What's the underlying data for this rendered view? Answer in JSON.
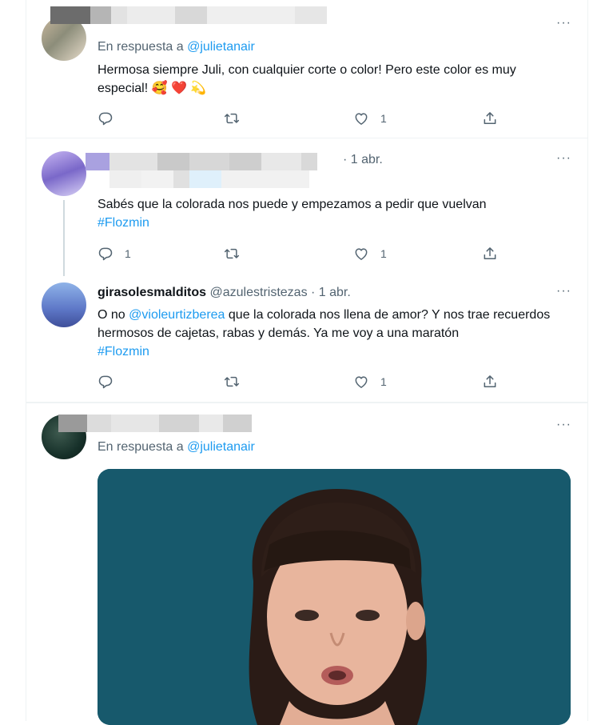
{
  "tweets": [
    {
      "reply_prefix": "En respuesta a",
      "reply_handle": "@julietanair",
      "text": "Hermosa siempre Juli, con cualquier corte o color! Pero este color es muy especial! 🥰 ❤️ 💫",
      "counts": {
        "reply": "",
        "retweet": "",
        "like": "1"
      }
    },
    {
      "meta_suffix": "· 1 abr.",
      "text": "Sabés que la colorada nos puede y empezamos a pedir que vuelvan",
      "hashtag": "#Flozmin",
      "counts": {
        "reply": "1",
        "retweet": "",
        "like": "1"
      }
    },
    {
      "display_name": "girasolesmalditos",
      "handle": "@azulestristezas",
      "meta_suffix": "· 1 abr.",
      "text_prefix": "O no",
      "mention": "@violeurtizberea",
      "text_rest": "que la colorada nos llena de amor? Y nos trae recuerdos hermosos de cajetas, rabas y demás.  Ya me voy a una maratón",
      "hashtag": "#Flozmin",
      "counts": {
        "reply": "",
        "retweet": "",
        "like": "1"
      }
    },
    {
      "reply_prefix": "En respuesta a",
      "reply_handle": "@julietanair"
    }
  ],
  "more_glyph": "···",
  "icons": [
    "reply-icon",
    "retweet-icon",
    "like-icon",
    "share-icon"
  ],
  "colors": {
    "accent": "#1d9bf0",
    "muted": "#536471",
    "text": "#0f1419",
    "border": "#eff3f4"
  }
}
